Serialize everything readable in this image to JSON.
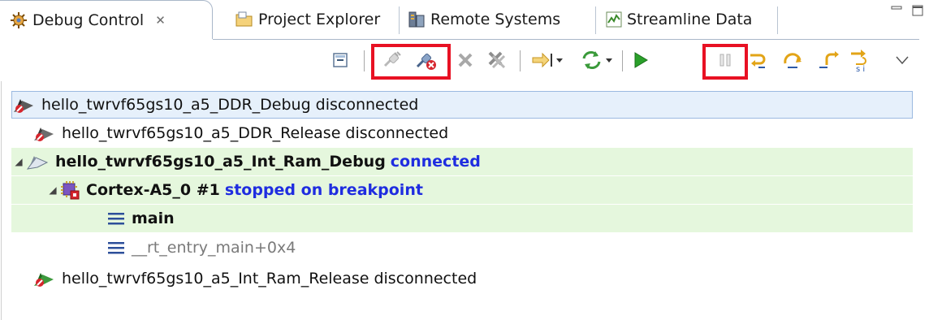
{
  "tabs": [
    {
      "label": "Debug Control",
      "close": "✕",
      "icon": "debug-control-icon",
      "active": true
    },
    {
      "label": "Project Explorer",
      "icon": "project-explorer-icon"
    },
    {
      "label": "Remote Systems",
      "icon": "remote-systems-icon"
    },
    {
      "label": "Streamline Data",
      "icon": "streamline-data-icon"
    }
  ],
  "toolbar": {
    "buttons": [
      "collapse-all",
      "connect-to-target",
      "disconnect-from-target",
      "remove-connection",
      "remove-all-connections",
      "step-source-level",
      "refresh",
      "continue",
      "interrupt",
      "step-into",
      "step-over",
      "step-out",
      "step-instruction",
      "view-menu"
    ],
    "highlight_color": "#e81123"
  },
  "tree": {
    "rows": [
      {
        "name": "hello_twrvf65gs10_a5_DDR_Debug",
        "state": "disconnected",
        "selected": true
      },
      {
        "name": "hello_twrvf65gs10_a5_DDR_Release",
        "state": "disconnected"
      },
      {
        "name": "hello_twrvf65gs10_a5_Int_Ram_Debug",
        "state": "connected",
        "expanded": true
      },
      {
        "name": "Cortex-A5_0 #1",
        "state": "stopped on breakpoint",
        "expanded": true
      },
      {
        "name": "main"
      },
      {
        "name": "__rt_entry_main+0x4"
      },
      {
        "name": "hello_twrvf65gs10_a5_Int_Ram_Release",
        "state": "disconnected"
      }
    ]
  },
  "colors": {
    "connected_text": "#1f2de0",
    "running_bg": "#e5f7dd",
    "selection_bg": "#e6f0fb"
  }
}
